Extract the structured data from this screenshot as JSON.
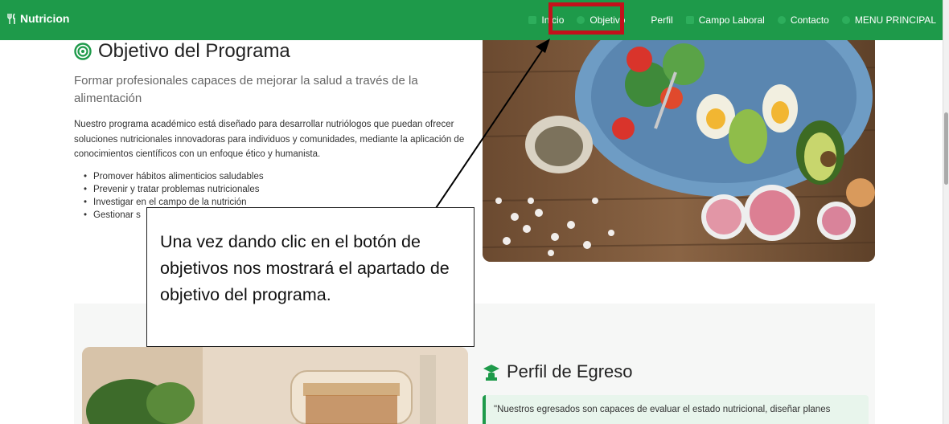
{
  "navbar": {
    "brand": "Nutricion",
    "items": [
      {
        "label": "Inicio",
        "icon": "home-icon"
      },
      {
        "label": "Objetivo",
        "icon": "target-icon"
      },
      {
        "label": "Perfil",
        "icon": "user-icon"
      },
      {
        "label": "Campo Laboral",
        "icon": "briefcase-icon"
      },
      {
        "label": "Contacto",
        "icon": "location-icon"
      },
      {
        "label": "MENU PRINCIPAL",
        "icon": "location-icon"
      }
    ],
    "color": "#1e9a4a"
  },
  "objective": {
    "title": "Objetivo del Programa",
    "subtitle": "Formar profesionales capaces de mejorar la salud a través de la alimentación",
    "description": "Nuestro programa académico está diseñado para desarrollar nutriólogos que puedan ofrecer soluciones nutricionales innovadoras para individuos y comunidades, mediante la aplicación de conocimientos científicos con un enfoque ético y humanista.",
    "bullets": [
      "Promover hábitos alimenticios saludables",
      "Prevenir y tratar problemas nutricionales",
      "Investigar en el campo de la nutrición",
      "Gestionar s"
    ]
  },
  "profile": {
    "title": "Perfil de Egreso",
    "quote": "\"Nuestros egresados son capaces de evaluar el estado nutricional, diseñar planes"
  },
  "callout": {
    "text": "Una vez dando clic en el botón de objetivos nos mostrará el apartado de objetivo del programa."
  },
  "highlight_color": "#c3111b"
}
